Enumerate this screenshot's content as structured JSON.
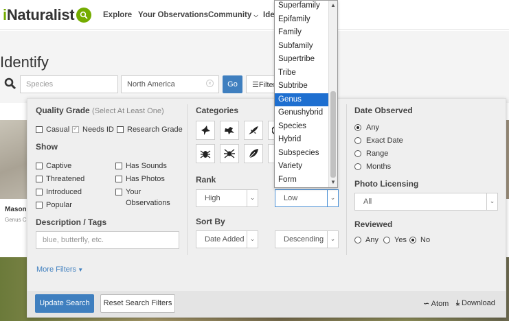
{
  "nav": {
    "logo_i": "i",
    "logo_rest": "Naturalist",
    "links": [
      "Explore",
      "Your Observations",
      "Community",
      "Ide"
    ]
  },
  "header": {
    "title": "Identify",
    "taxon_placeholder": "Species",
    "place_value": "North America",
    "go_label": "Go",
    "filters_label": "Filters"
  },
  "background": {
    "card_title": "Mason",
    "card_sub": "Genus C"
  },
  "filters": {
    "quality_grade": {
      "heading": "Quality Grade",
      "hint": "(Select At Least One)",
      "options": [
        {
          "label": "Casual",
          "checked": false
        },
        {
          "label": "Needs ID",
          "checked": true
        },
        {
          "label": "Research Grade",
          "checked": false
        }
      ]
    },
    "show": {
      "heading": "Show",
      "left": [
        "Captive",
        "Threatened",
        "Introduced",
        "Popular"
      ],
      "right": [
        "Has Sounds",
        "Has Photos",
        "Your",
        "Observations"
      ]
    },
    "description": {
      "heading": "Description / Tags",
      "placeholder": "blue, butterfly, etc."
    },
    "more_filters": "More Filters",
    "categories": {
      "heading": "Categories",
      "icons": [
        "bird-icon",
        "amphibian-icon",
        "reptile-icon",
        "mammal-icon",
        "insect-icon",
        "arachnid-icon",
        "plant-icon",
        "fungi-icon"
      ]
    },
    "rank": {
      "heading": "Rank",
      "high": "High",
      "low": "Low"
    },
    "sort_by": {
      "heading": "Sort By",
      "field": "Date Added",
      "order": "Descending"
    },
    "date_observed": {
      "heading": "Date Observed",
      "options": [
        {
          "label": "Any",
          "on": true
        },
        {
          "label": "Exact Date",
          "on": false
        },
        {
          "label": "Range",
          "on": false
        },
        {
          "label": "Months",
          "on": false
        }
      ]
    },
    "photo_licensing": {
      "heading": "Photo Licensing",
      "value": "All"
    },
    "reviewed": {
      "heading": "Reviewed",
      "options": [
        {
          "label": "Any",
          "on": false
        },
        {
          "label": "Yes",
          "on": false
        },
        {
          "label": "No",
          "on": true
        }
      ]
    },
    "footer": {
      "update": "Update Search",
      "reset": "Reset Search Filters",
      "atom": "Atom",
      "download": "Download"
    }
  },
  "rank_dropdown": {
    "items": [
      "Superfamily",
      "Epifamily",
      "Family",
      "Subfamily",
      "Supertribe",
      "Tribe",
      "Subtribe",
      "Genus",
      "Genushybrid",
      "Species",
      "Hybrid",
      "Subspecies",
      "Variety",
      "Form"
    ],
    "selected": "Genus"
  },
  "colors": {
    "brand_green": "#74ac00",
    "primary_blue": "#3f7fbf",
    "selection_blue": "#1e6fd0"
  }
}
